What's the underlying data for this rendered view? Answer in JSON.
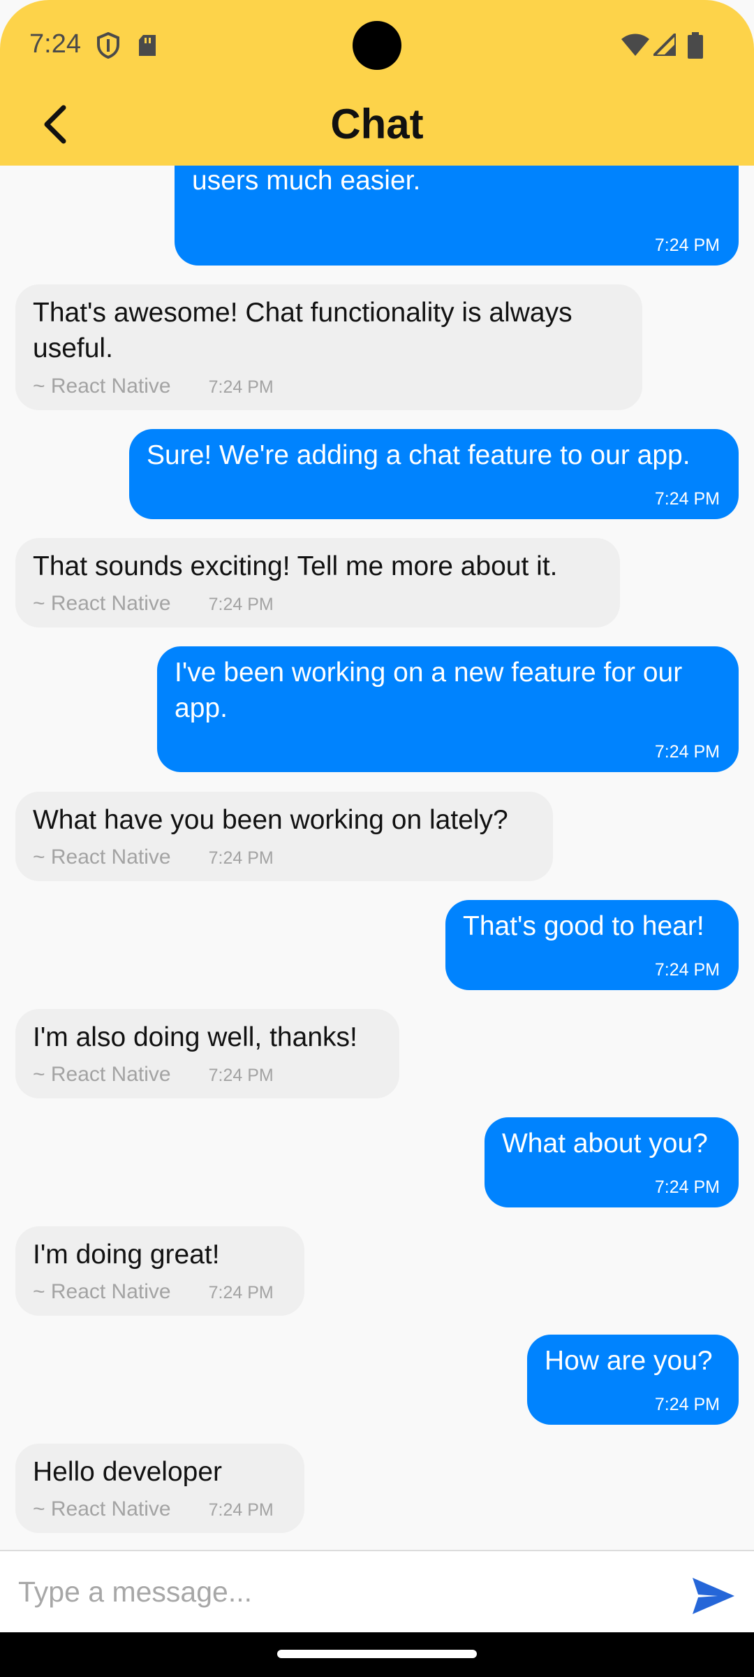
{
  "status_bar": {
    "time": "7:24"
  },
  "header": {
    "title": "Chat",
    "back_icon": "chevron-left-icon"
  },
  "messages": [
    {
      "from": "me",
      "text": "Yes, it will make communication between\nusers much easier.",
      "time": "7:24 PM"
    },
    {
      "from": "other",
      "text": "That's awesome! Chat functionality is always\nuseful.",
      "sender": "~ React Native",
      "time": "7:24 PM"
    },
    {
      "from": "me",
      "text": "Sure! We're adding a chat feature to our app.",
      "time": "7:24 PM"
    },
    {
      "from": "other",
      "text": "That sounds exciting! Tell me more about it.",
      "sender": "~ React Native",
      "time": "7:24 PM"
    },
    {
      "from": "me",
      "text": "I've been working on a new feature for our\napp.",
      "time": "7:24 PM"
    },
    {
      "from": "other",
      "text": "What have you been working on lately?",
      "sender": "~ React Native",
      "time": "7:24 PM"
    },
    {
      "from": "me",
      "text": "That's good to hear!",
      "time": "7:24 PM"
    },
    {
      "from": "other",
      "text": "I'm also doing well, thanks!",
      "sender": "~ React Native",
      "time": "7:24 PM"
    },
    {
      "from": "me",
      "text": "What about you?",
      "time": "7:24 PM"
    },
    {
      "from": "other",
      "text": "I'm doing great!",
      "sender": "~ React Native",
      "time": "7:24 PM"
    },
    {
      "from": "me",
      "text": "How are you?",
      "time": "7:24 PM"
    },
    {
      "from": "other",
      "text": "Hello developer",
      "sender": "~ React Native",
      "time": "7:24 PM"
    }
  ],
  "composer": {
    "placeholder": "Type a message...",
    "send_icon": "send-icon"
  },
  "colors": {
    "header": "#fdd34a",
    "sent_bubble": "#0083fe",
    "received_bubble": "#efefef",
    "background": "#f9f9f9",
    "send_icon": "#2566d8"
  }
}
